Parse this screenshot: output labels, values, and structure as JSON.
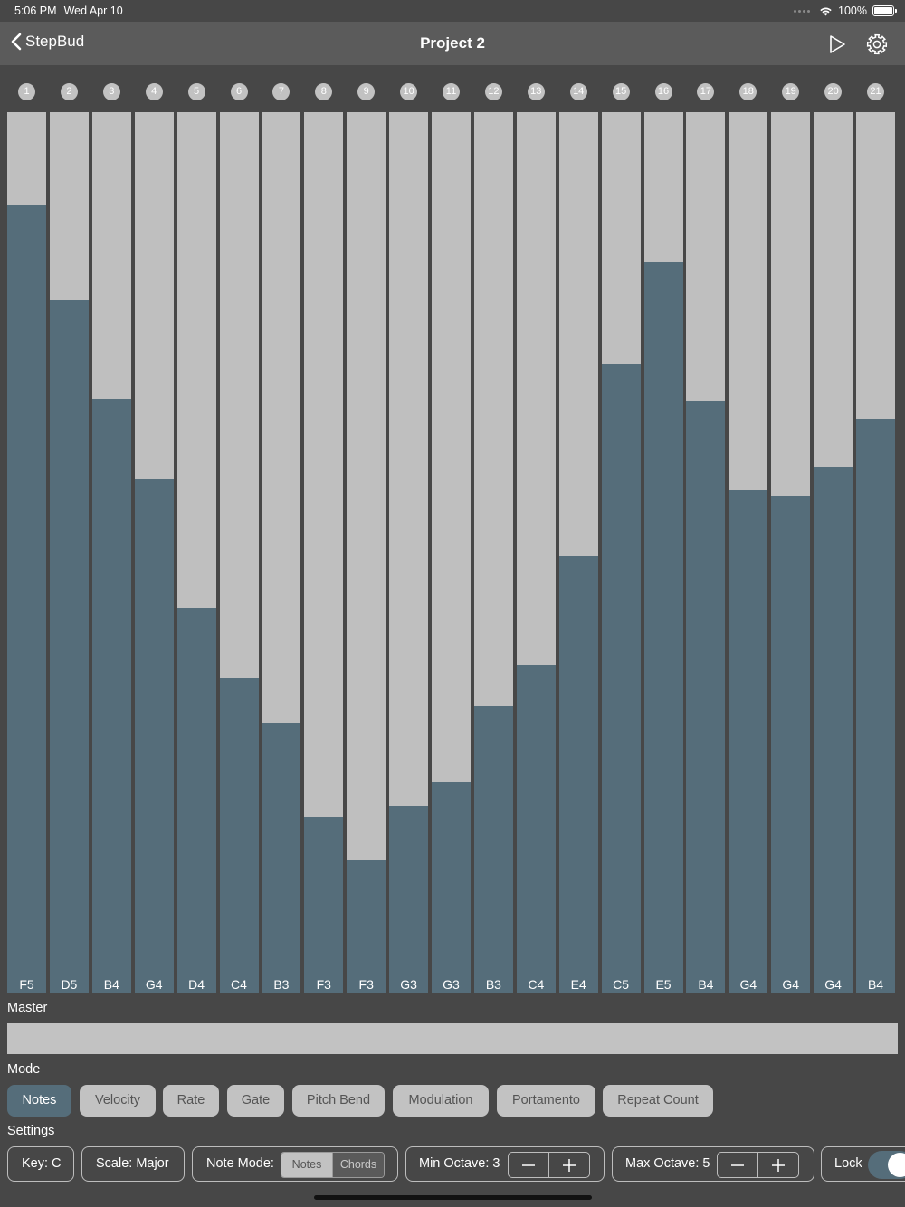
{
  "status_bar": {
    "time": "5:06 PM",
    "date": "Wed Apr 10",
    "battery": "100%"
  },
  "nav": {
    "back_label": "StepBud",
    "title": "Project 2"
  },
  "steps": [
    {
      "n": "1",
      "note": "F5",
      "level": 0.894
    },
    {
      "n": "2",
      "note": "D5",
      "level": 0.786
    },
    {
      "n": "3",
      "note": "B4",
      "level": 0.674
    },
    {
      "n": "4",
      "note": "G4",
      "level": 0.584
    },
    {
      "n": "5",
      "note": "D4",
      "level": 0.437
    },
    {
      "n": "6",
      "note": "C4",
      "level": 0.358
    },
    {
      "n": "7",
      "note": "B3",
      "level": 0.306
    },
    {
      "n": "8",
      "note": "F3",
      "level": 0.199
    },
    {
      "n": "9",
      "note": "F3",
      "level": 0.151
    },
    {
      "n": "10",
      "note": "G3",
      "level": 0.212
    },
    {
      "n": "11",
      "note": "G3",
      "level": 0.239
    },
    {
      "n": "12",
      "note": "B3",
      "level": 0.326
    },
    {
      "n": "13",
      "note": "C4",
      "level": 0.372
    },
    {
      "n": "14",
      "note": "E4",
      "level": 0.495
    },
    {
      "n": "15",
      "note": "C5",
      "level": 0.714
    },
    {
      "n": "16",
      "note": "E5",
      "level": 0.829
    },
    {
      "n": "17",
      "note": "B4",
      "level": 0.672
    },
    {
      "n": "18",
      "note": "G4",
      "level": 0.57
    },
    {
      "n": "19",
      "note": "G4",
      "level": 0.564
    },
    {
      "n": "20",
      "note": "G4",
      "level": 0.597
    },
    {
      "n": "21",
      "note": "B4",
      "level": 0.652
    }
  ],
  "master": {
    "label": "Master"
  },
  "mode": {
    "label": "Mode",
    "active": "Notes",
    "buttons": [
      "Notes",
      "Velocity",
      "Rate",
      "Gate",
      "Pitch Bend",
      "Modulation",
      "Portamento",
      "Repeat Count"
    ]
  },
  "settings": {
    "label": "Settings",
    "key": "Key: C",
    "scale": "Scale: Major",
    "note_mode_label": "Note Mode:",
    "note_mode_options": [
      "Notes",
      "Chords"
    ],
    "note_mode_selected": "Notes",
    "min_octave": "Min Octave: 3",
    "max_octave": "Max Octave: 5",
    "lock": "Lock",
    "lock_on": true
  },
  "colors": {
    "background": "#474747",
    "nav_bar": "#5b5b5b",
    "bar_track": "#bfbfbf",
    "bar_fill": "#556d7a",
    "accent": "#556d7a"
  },
  "icons": [
    "chevron-left-icon",
    "play-icon",
    "gear-icon",
    "wifi-icon",
    "battery-icon",
    "minus-icon",
    "plus-icon"
  ]
}
